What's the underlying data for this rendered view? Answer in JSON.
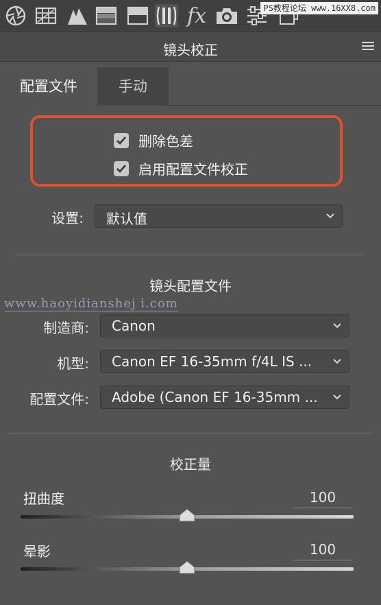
{
  "toolbar": {
    "icons": [
      "aperture-icon",
      "grid-icon",
      "curve-icon",
      "hsl-icon",
      "split-toning-icon",
      "lens-icon",
      "fx-icon",
      "camera-icon",
      "presets-icon",
      "snapshots-icon"
    ],
    "fx_label": "fx",
    "watermark": "PS教程论坛 www.16XX8.com"
  },
  "panel": {
    "title": "镜头校正"
  },
  "tabs": [
    {
      "label": "配置文件",
      "active": true
    },
    {
      "label": "手动",
      "active": false
    }
  ],
  "checks": {
    "remove_chromatic_aberration": {
      "label": "删除色差",
      "checked": true
    },
    "enable_profile_corrections": {
      "label": "启用配置文件校正",
      "checked": true
    }
  },
  "setup": {
    "label": "设置:",
    "value": "默认值"
  },
  "lens_profile": {
    "title": "镜头配置文件",
    "watermark": "www.haoyidianshej i.com",
    "make": {
      "label": "制造商:",
      "value": "Canon"
    },
    "model": {
      "label": "机型:",
      "value": "Canon EF 16-35mm f/4L IS ..."
    },
    "profile": {
      "label": "配置文件:",
      "value": "Adobe (Canon EF 16-35mm ..."
    }
  },
  "correction_amount": {
    "title": "校正量",
    "distortion": {
      "label": "扭曲度",
      "value": "100",
      "position": 0.5
    },
    "vignetting": {
      "label": "晕影",
      "value": "100",
      "position": 0.5
    }
  },
  "colors": {
    "background": "#535353",
    "toolbar": "#404040",
    "highlight_border": "#e0512b"
  }
}
